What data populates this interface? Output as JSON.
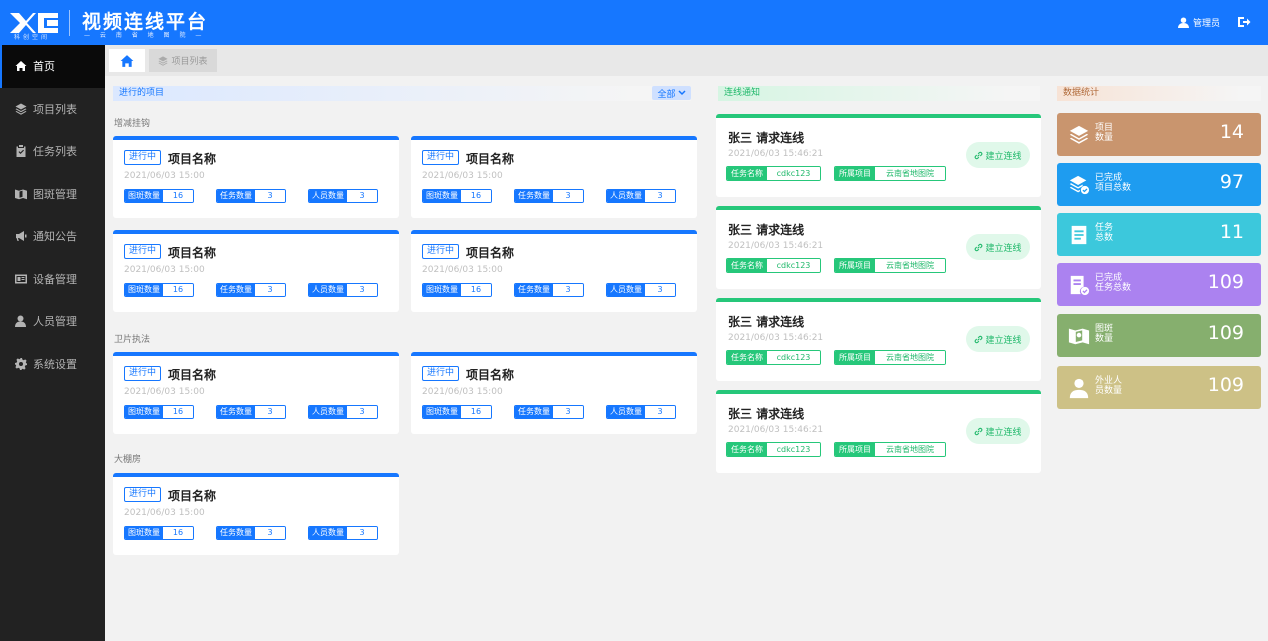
{
  "header": {
    "logo_text": "科创空间",
    "title": "视频连线平台",
    "subtitle": "— 云 南 省 地 图 院 —",
    "user": "管理员"
  },
  "sidebar": {
    "items": [
      {
        "label": "首页",
        "icon": "home-icon"
      },
      {
        "label": "项目列表",
        "icon": "layers-icon"
      },
      {
        "label": "任务列表",
        "icon": "clipboard-icon"
      },
      {
        "label": "图斑管理",
        "icon": "map-icon"
      },
      {
        "label": "通知公告",
        "icon": "megaphone-icon"
      },
      {
        "label": "设备管理",
        "icon": "device-icon"
      },
      {
        "label": "人员管理",
        "icon": "person-icon"
      },
      {
        "label": "系统设置",
        "icon": "gear-icon"
      }
    ]
  },
  "breadcrumb": {
    "project_tab": "项目列表"
  },
  "projects": {
    "heading": "进行的项目",
    "filter": "全部",
    "groups": [
      "增减挂钩",
      "卫片执法",
      "大棚房"
    ],
    "card": {
      "status": "进行中",
      "name": "项目名称",
      "date": "2021/06/03  15:00",
      "spot_label": "图斑数量",
      "spot_value": "16",
      "task_label": "任务数量",
      "task_value": "3",
      "people_label": "人员数量",
      "people_value": "3"
    }
  },
  "notices": {
    "heading": "连线通知",
    "card": {
      "title": "张三 请求连线",
      "date": "2021/06/03 15:46:21",
      "button": "建立连线",
      "task_label": "任务名称",
      "task_value": "cdkc123",
      "project_label": "所属项目",
      "project_value": "云南省地图院"
    }
  },
  "stats": {
    "heading": "数据统计",
    "items": [
      {
        "l1": "项目",
        "l2": "数量",
        "value": "14",
        "color": "#c9956e",
        "icon": "layers-icon"
      },
      {
        "l1": "已完成",
        "l2": "项目总数",
        "value": "97",
        "color": "#1e9cf0",
        "icon": "layers-check-icon"
      },
      {
        "l1": "任务",
        "l2": "总数",
        "value": "11",
        "color": "#3cc8dc",
        "icon": "document-icon"
      },
      {
        "l1": "已完成",
        "l2": "任务总数",
        "value": "109",
        "color": "#ab82f0",
        "icon": "document-check-icon"
      },
      {
        "l1": "图斑",
        "l2": "数量",
        "value": "109",
        "color": "#86af6e",
        "icon": "map-icon"
      },
      {
        "l1": "外业人",
        "l2": "员数量",
        "value": "109",
        "color": "#cdc186",
        "icon": "person-icon"
      }
    ]
  }
}
